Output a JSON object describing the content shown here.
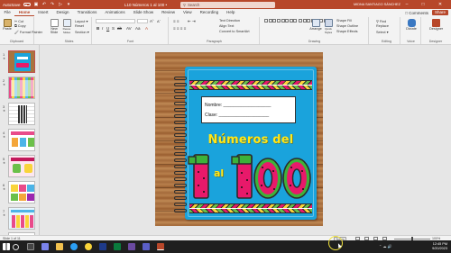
{
  "titlebar": {
    "autosave": "AutoSave",
    "autosave_state": "Off",
    "doc_title": "L10 Números 1 al 100  •",
    "search_placeholder": "Search",
    "user": "MIDNA SANTIAGO SÁNCHEZ"
  },
  "menu": {
    "tabs": [
      "File",
      "Home",
      "Insert",
      "Design",
      "Transitions",
      "Animations",
      "Slide Show",
      "Review",
      "View",
      "Recording",
      "Help"
    ],
    "active_tab": "Home",
    "comments": "Comments",
    "share": "Share"
  },
  "ribbon": {
    "clipboard": {
      "paste": "Paste",
      "cut": "Cut",
      "copy": "Copy",
      "format_painter": "Format Painter",
      "name": "Clipboard"
    },
    "slides": {
      "new_slide": "New Slide",
      "reuse": "Reuse Slides",
      "layout": "Layout",
      "reset": "Reset",
      "section": "Section",
      "name": "Slides"
    },
    "font": {
      "name": "Font"
    },
    "paragraph": {
      "text_direction": "Text Direction",
      "align_text": "Align Text",
      "smartart": "Convert to SmartArt",
      "name": "Paragraph"
    },
    "drawing": {
      "arrange": "Arrange",
      "quick_styles": "Quick Styles",
      "shape_fill": "Shape Fill",
      "shape_outline": "Shape Outline",
      "shape_effects": "Shape Effects",
      "name": "Drawing"
    },
    "editing": {
      "find": "Find",
      "replace": "Replace",
      "select": "Select",
      "name": "Editing"
    },
    "voice": {
      "dictate": "Dictate",
      "name": "Voice"
    },
    "designer": {
      "label": "Designer",
      "name": "Designer"
    }
  },
  "slides_panel": {
    "numbers": [
      "1",
      "2",
      "3",
      "4",
      "5",
      "6",
      "7",
      "8"
    ],
    "selected": "1"
  },
  "slide": {
    "nombre_label": "Nombre: ___________________",
    "clase_label": "Clase: ____________________",
    "headline": "Números del",
    "al": "al",
    "num_1": "1",
    "num_100": "100"
  },
  "status": {
    "slide_count": "Slide 1 of 11",
    "notes": "Notes",
    "zoom": "100%"
  },
  "taskbar": {
    "time": "12:45 PM",
    "date": "9/20/2023"
  },
  "colors": {
    "accent": "#b7472a",
    "notebook": "#1aa3dc",
    "headline": "#ffe81a",
    "numbers_fill": "#e8196a",
    "numbers_rind": "#3db23a"
  }
}
